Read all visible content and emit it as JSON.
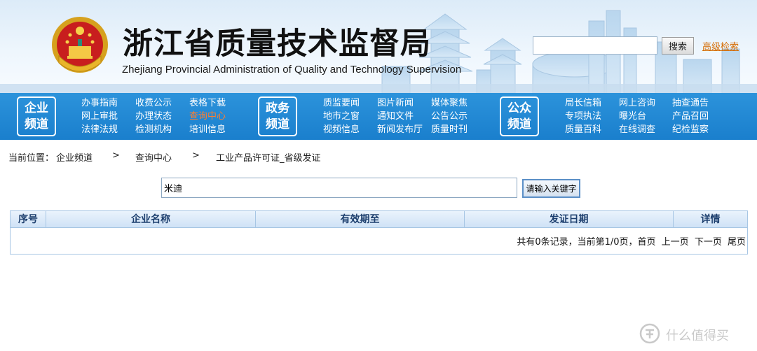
{
  "header": {
    "title": "浙江省质量技术监督局",
    "subtitle": "Zhejiang Provincial Administration of Quality and Technology Supervision",
    "search_value": "",
    "search_button": "搜索",
    "advanced_search": "高级检索",
    "emblem": "national-emblem-icon"
  },
  "nav": {
    "channels": [
      {
        "line1": "企业",
        "line2": "频道"
      },
      {
        "line1": "政务",
        "line2": "频道"
      },
      {
        "line1": "公众",
        "line2": "频道"
      }
    ],
    "columns": [
      [
        "办事指南",
        "网上审批",
        "法律法规"
      ],
      [
        "收费公示",
        "办理状态",
        "检测机构"
      ],
      [
        "表格下载",
        "查询中心",
        "培训信息"
      ],
      [
        "质监要闻",
        "地市之窗",
        "视频信息"
      ],
      [
        "图片新闻",
        "通知文件",
        "新闻发布厅"
      ],
      [
        "媒体聚焦",
        "公告公示",
        "质量时刊"
      ],
      [
        "局长信箱",
        "专项执法",
        "质量百科"
      ],
      [
        "网上咨询",
        "曝光台",
        "在线调查"
      ],
      [
        "抽查通告",
        "产品召回",
        "纪检监察"
      ]
    ],
    "active_color": "#ff7e2e",
    "bar_color": "#1f86d2"
  },
  "breadcrumb": {
    "prefix": "当前位置：",
    "items": [
      "企业频道",
      "查询中心",
      "工业产品许可证_省级发证"
    ],
    "separator": ">"
  },
  "query": {
    "input_value": "米迪",
    "button_label": "请输入关键字"
  },
  "table": {
    "headers": [
      "序号",
      "企业名称",
      "有效期至",
      "发证日期",
      "详情"
    ],
    "rows": [],
    "summary": "共有0条记录，当前第1/0页，",
    "pager": [
      "首页",
      "上一页",
      "下一页",
      "尾页"
    ]
  },
  "watermark": {
    "text": "什么值得买",
    "logo": "zhi-logo-icon"
  }
}
